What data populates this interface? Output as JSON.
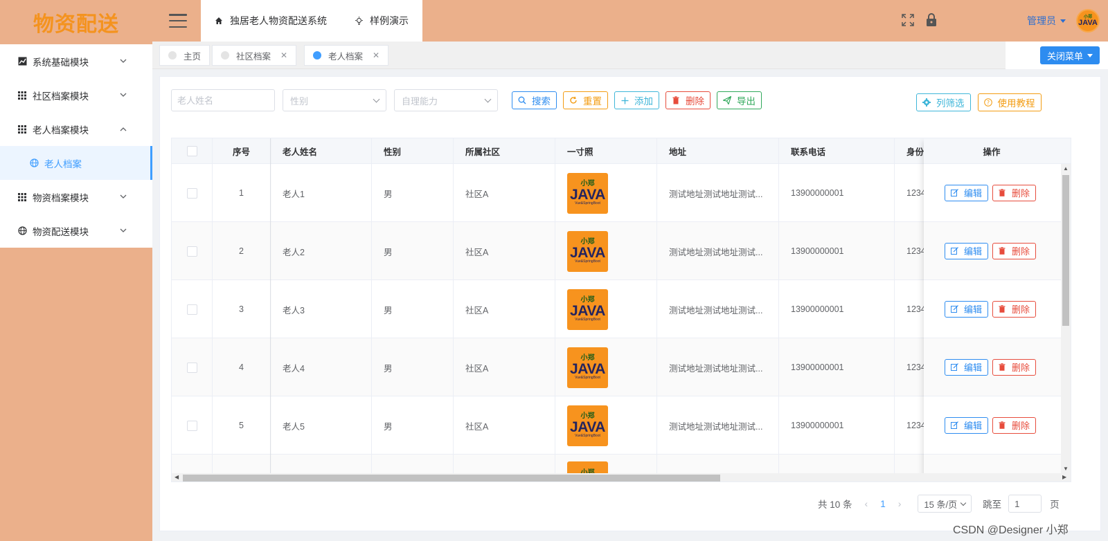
{
  "app": {
    "logo": "物资配送"
  },
  "sidebar": {
    "items": [
      {
        "label": "系统基础模块",
        "icon": "chart-icon",
        "expanded": false
      },
      {
        "label": "社区档案模块",
        "icon": "grid-icon",
        "expanded": false
      },
      {
        "label": "老人档案模块",
        "icon": "grid-icon",
        "expanded": true
      },
      {
        "label": "物资档案模块",
        "icon": "grid-icon",
        "expanded": false
      },
      {
        "label": "物资配送模块",
        "icon": "globe-icon",
        "expanded": false
      }
    ],
    "active_sub": "老人档案"
  },
  "header": {
    "tabs": [
      {
        "label": "独居老人物资配送系统",
        "icon": "home-icon"
      },
      {
        "label": "样例演示",
        "icon": "bulb-icon"
      }
    ],
    "user": "管理员",
    "avatar_line1": "小郑",
    "avatar_line2": "JAVA"
  },
  "tags": [
    {
      "label": "主页",
      "active": false,
      "closable": false
    },
    {
      "label": "社区档案",
      "active": false,
      "closable": true
    },
    {
      "label": "老人档案",
      "active": true,
      "closable": true
    }
  ],
  "close_menu_label": "关闭菜单",
  "filters": {
    "name_placeholder": "老人姓名",
    "gender_placeholder": "性别",
    "ability_placeholder": "自理能力"
  },
  "buttons": {
    "search": "搜索",
    "reset": "重置",
    "add": "添加",
    "delete": "删除",
    "export": "导出",
    "column_filter": "列筛选",
    "tutorial": "使用教程"
  },
  "table": {
    "columns": [
      "序号",
      "老人姓名",
      "性别",
      "所属社区",
      "一寸照",
      "地址",
      "联系电话",
      "身份",
      "操作"
    ],
    "photo": {
      "line1": "小郑",
      "line2": "JAVA",
      "line3": "Vue&SpringBoot"
    },
    "rows": [
      {
        "index": "1",
        "name": "老人1",
        "gender": "男",
        "community": "社区A",
        "address": "测试地址测试地址测试...",
        "phone": "13900000001",
        "id": "1234"
      },
      {
        "index": "2",
        "name": "老人2",
        "gender": "男",
        "community": "社区A",
        "address": "测试地址测试地址测试...",
        "phone": "13900000001",
        "id": "1234"
      },
      {
        "index": "3",
        "name": "老人3",
        "gender": "男",
        "community": "社区A",
        "address": "测试地址测试地址测试...",
        "phone": "13900000001",
        "id": "1234"
      },
      {
        "index": "4",
        "name": "老人4",
        "gender": "男",
        "community": "社区A",
        "address": "测试地址测试地址测试...",
        "phone": "13900000001",
        "id": "1234"
      },
      {
        "index": "5",
        "name": "老人5",
        "gender": "男",
        "community": "社区A",
        "address": "测试地址测试地址测试...",
        "phone": "13900000001",
        "id": "1234"
      }
    ],
    "row_actions": {
      "edit": "编辑",
      "delete": "删除"
    }
  },
  "pagination": {
    "total": "共 10 条",
    "current_page": "1",
    "page_size": "15 条/页",
    "jump_label": "跳至",
    "jump_value": "1",
    "page_suffix": "页"
  },
  "watermark": "CSDN @Designer 小郑",
  "colors": {
    "accent": "#409eff",
    "sidebar_bg": "#ebb08b",
    "logo": "#f4931f"
  }
}
